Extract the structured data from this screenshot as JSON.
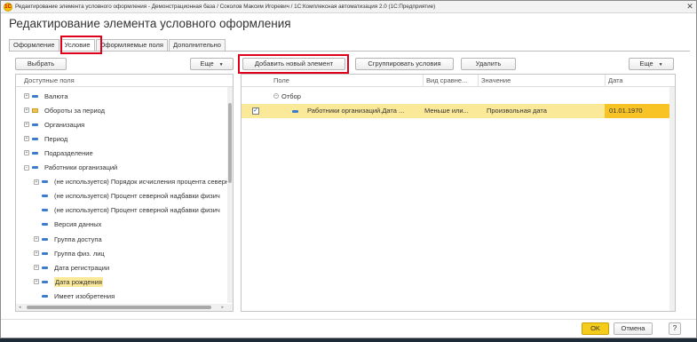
{
  "window": {
    "title": "Редактирование элемента условного оформления - Демонстрационная база / Соколов Максим Игоревич / 1С:Комплексная автоматизация 2.0  (1С:Предприятие)",
    "logo": "1С"
  },
  "form": {
    "title": "Редактирование элемента условного оформления"
  },
  "tabs": [
    "Оформление",
    "Условие",
    "Оформляемые поля",
    "Дополнительно"
  ],
  "left_panel": {
    "select_button": "Выбрать",
    "more_button": "Еще",
    "header": "Доступные поля",
    "items": [
      {
        "label": "Валюта",
        "icon": "field-icon",
        "expand": "+"
      },
      {
        "label": "Обороты за период",
        "icon": "folder-icon",
        "expand": "+"
      },
      {
        "label": "Организация",
        "icon": "field-icon",
        "expand": "+"
      },
      {
        "label": "Период",
        "icon": "field-icon",
        "expand": "+"
      },
      {
        "label": "Подразделение",
        "icon": "field-icon",
        "expand": "+"
      },
      {
        "label": "Работники организаций",
        "icon": "field-icon",
        "expand": "−"
      },
      {
        "label": "(не используется) Порядок исчисления процента северн",
        "icon": "field-icon",
        "expand": "+"
      },
      {
        "label": "(не используется) Процент северной надбавки физич",
        "icon": "field-icon",
        "expand": ""
      },
      {
        "label": "(не используется) Процент северной надбавки физич",
        "icon": "field-icon",
        "expand": ""
      },
      {
        "label": "Версия данных",
        "icon": "field-icon",
        "expand": ""
      },
      {
        "label": "Группа доступа",
        "icon": "field-icon",
        "expand": "+"
      },
      {
        "label": "Группа физ. лиц",
        "icon": "field-icon",
        "expand": "+"
      },
      {
        "label": "Дата регистрации",
        "icon": "field-icon",
        "expand": "+"
      },
      {
        "label": "Дата рождения",
        "icon": "field-icon",
        "expand": "+"
      },
      {
        "label": "Имеет изобретения",
        "icon": "field-icon",
        "expand": ""
      }
    ]
  },
  "right_panel": {
    "add_button": "Добавить новый элемент",
    "group_button": "Сгруппировать условия",
    "delete_button": "Удалить",
    "more_button": "Еще",
    "columns": [
      "Поле",
      "Вид сравне...",
      "Значение",
      "Дата"
    ],
    "group_label": "Отбор",
    "group_expand": "−",
    "row": {
      "checked": "✓",
      "field": "Работники организаций.Дата ...",
      "comparison": "Меньше или...",
      "value": "Произвольная дата",
      "date": "01.01.1970"
    }
  },
  "footer": {
    "ok": "OK",
    "cancel": "Отмена",
    "help": "?"
  },
  "colors": {
    "accent_yellow": "#f5cc1c",
    "highlight_red": "#e0001b",
    "selection_yellow": "#fbe99a"
  }
}
